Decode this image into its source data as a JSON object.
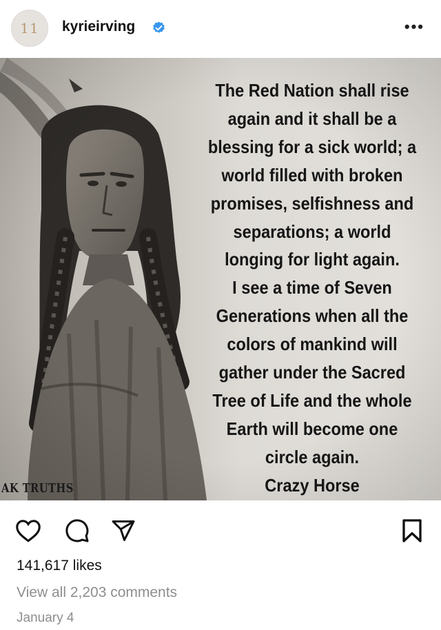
{
  "header": {
    "avatar_text": "11",
    "username": "kyrieirving",
    "verified_icon": "verified-badge-icon",
    "more_label": "•••"
  },
  "post": {
    "quote_lines": [
      "The Red Nation shall rise",
      "again and it shall be a",
      "blessing for a sick world; a",
      "world filled with broken",
      "promises, selfishness and",
      "separations; a world",
      "longing for light again.",
      "I see a time of Seven",
      "Generations when all the",
      "colors of mankind will",
      "gather under the Sacred",
      "Tree of Life and the whole",
      "Earth will become one",
      "circle again.",
      "Crazy Horse"
    ],
    "watermark": "AK TRUTHS"
  },
  "actions": {
    "icons": [
      "heart-icon",
      "comment-icon",
      "share-icon",
      "bookmark-icon"
    ]
  },
  "stats": {
    "likes": "141,617 likes",
    "comments": "View all 2,203 comments",
    "date": "January 4"
  },
  "colors": {
    "text": "#111111",
    "muted": "#8e8e8e",
    "verified": "#3897f0"
  }
}
